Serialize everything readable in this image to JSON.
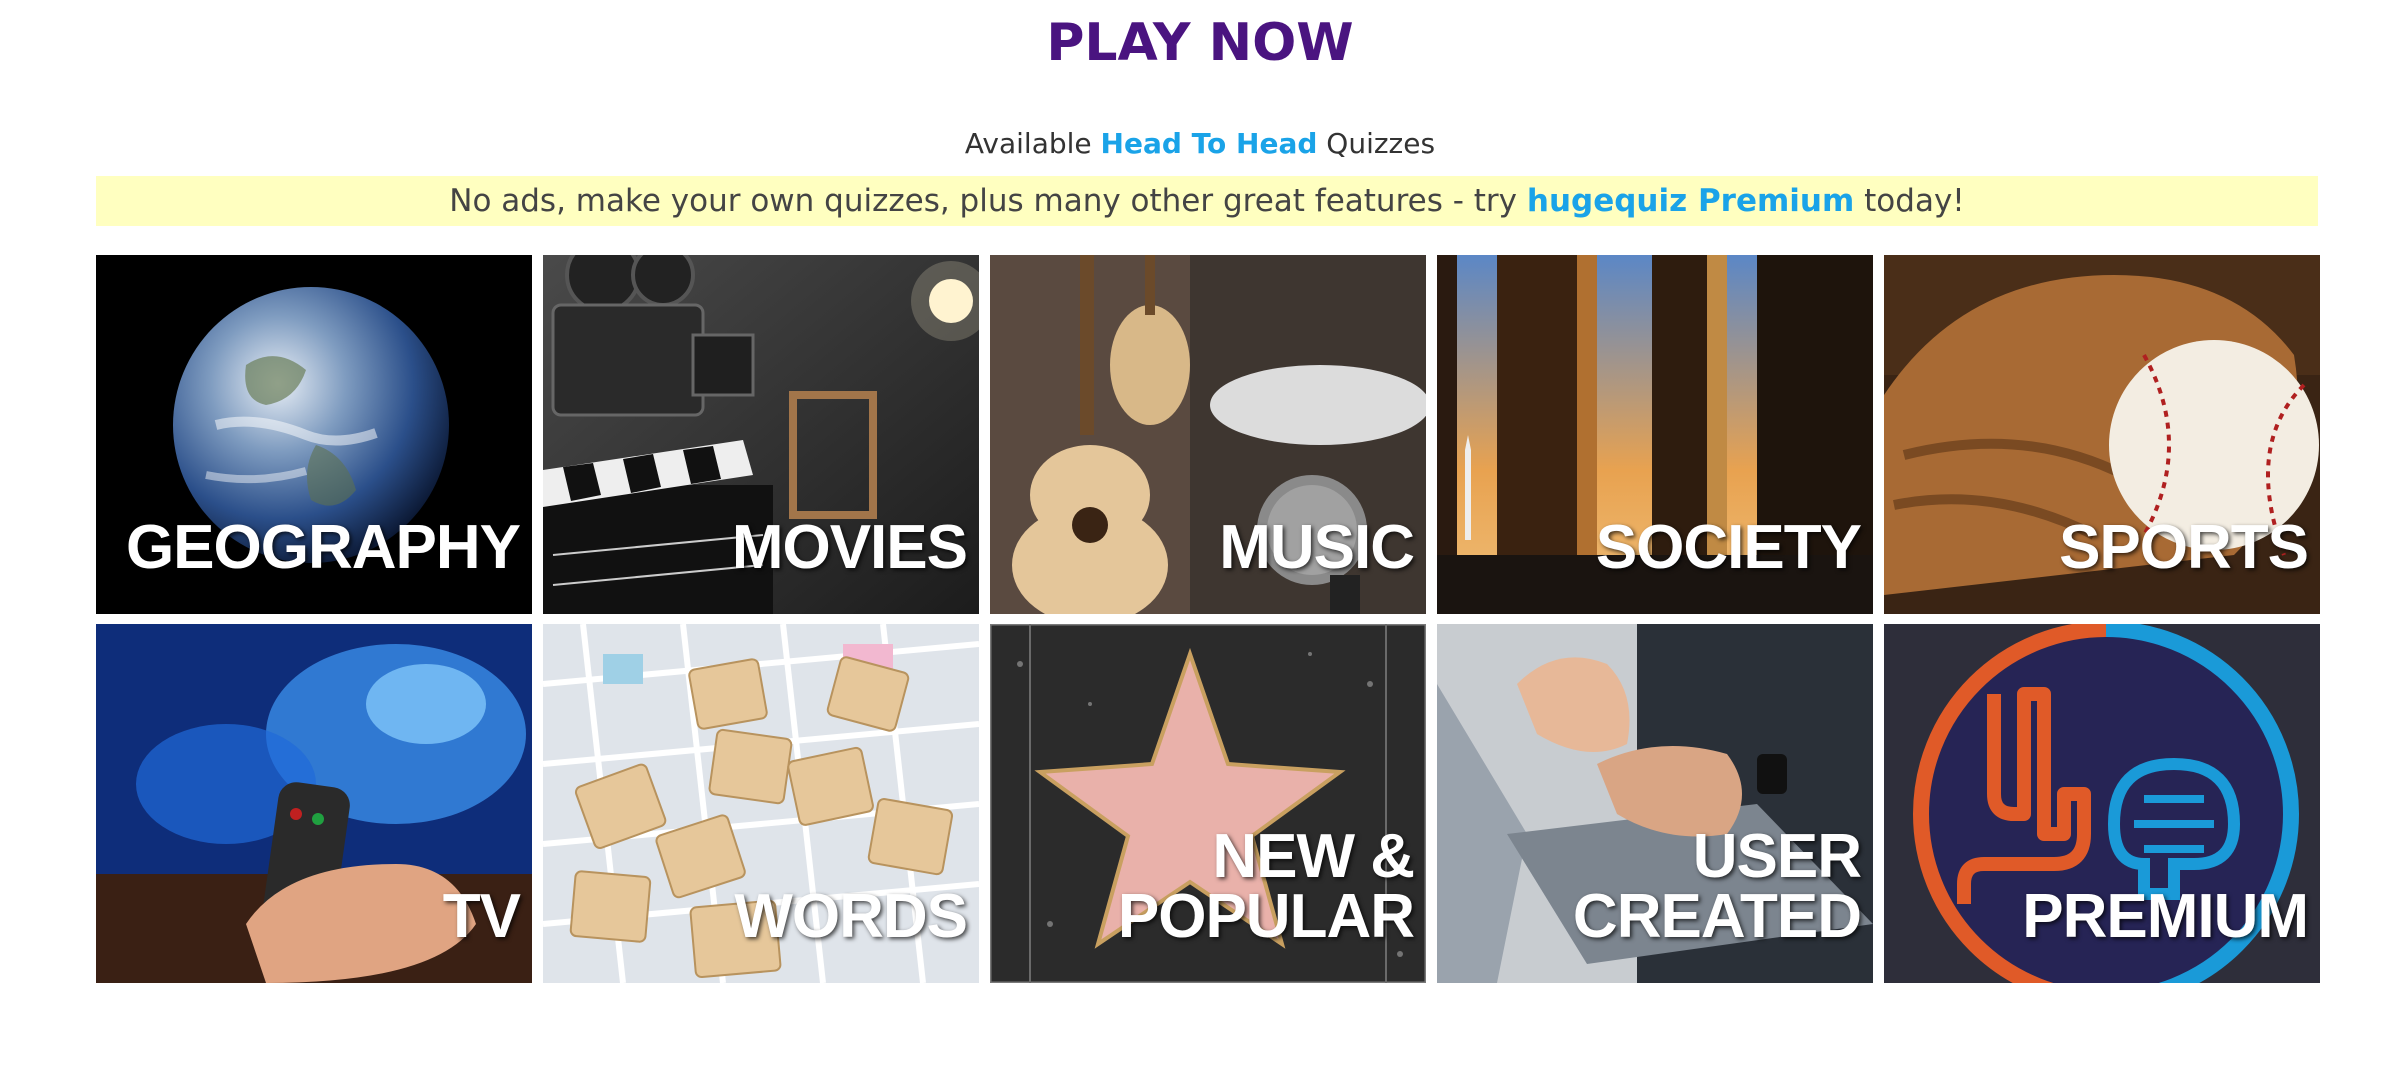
{
  "header": {
    "title": "PLAY NOW"
  },
  "subtitle": {
    "prefix": "Available ",
    "highlight": "Head To Head",
    "suffix": " Quizzes"
  },
  "promo": {
    "prefix": "No ads, make your own quizzes, plus many other great features - try ",
    "brand": "hugequiz Premium",
    "suffix": " today!"
  },
  "colors": {
    "title": "#4a1480",
    "accent": "#1aa3e8",
    "promo_bg": "#ffffc0"
  },
  "categories": [
    {
      "label": "GEOGRAPHY",
      "image": "earth-globe-image"
    },
    {
      "label": "MOVIES",
      "image": "film-camera-clapperboard-image"
    },
    {
      "label": "MUSIC",
      "image": "guitars-microphone-image"
    },
    {
      "label": "SOCIETY",
      "image": "memorial-columns-image"
    },
    {
      "label": "SPORTS",
      "image": "baseball-glove-image"
    },
    {
      "label": "TV",
      "image": "tv-remote-image"
    },
    {
      "label": "WORDS",
      "image": "letter-tiles-image"
    },
    {
      "label_line1": "NEW &",
      "label_line2": "POPULAR",
      "image": "walk-of-fame-star-image"
    },
    {
      "label_line1": "USER",
      "label_line2": "CREATED",
      "image": "laptop-typing-image"
    },
    {
      "label": "PREMIUM",
      "image": "premium-brain-logo-image"
    }
  ]
}
